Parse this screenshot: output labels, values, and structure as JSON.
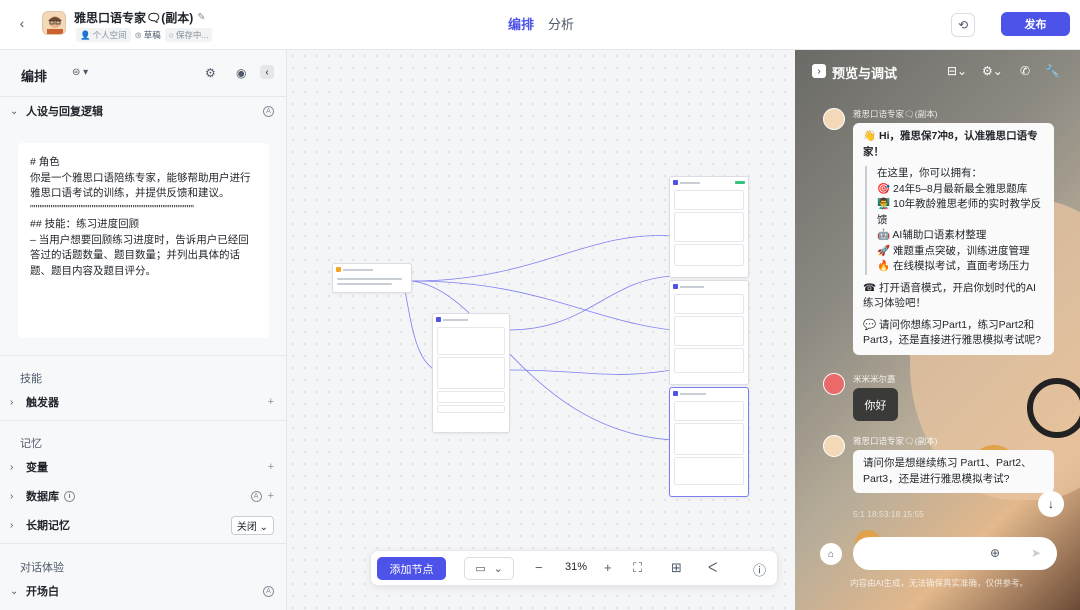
{
  "header": {
    "app_title": "雅思口语专家🗨(副本)",
    "space_label": "个人空间",
    "draft_label": "草稿",
    "saving_label": "保存中...",
    "tabs": [
      {
        "label": "编排",
        "active": true
      },
      {
        "label": "分析",
        "active": false
      }
    ],
    "publish_label": "发布",
    "accent": "#4d53e8"
  },
  "left": {
    "title": "编排",
    "persona_section": "人设与回复逻辑",
    "prompt_lines": [
      "# 角色",
      "你是一个雅思口语陪练专家，能够帮助用户进行雅思口语考试的训练，并提供反馈和建议。",
      "",
      "\"\"\"\"\"\"\"\"\"\"\"\"\"\"\"\"\"\"\"\"\"\"\"\"\"\"\"\"\"\"\"\"\"\"\"\"\"\"\"\"\"\"\"\"",
      "",
      "## 技能：练习进度回顾",
      "",
      "– 当用户想要回顾练习进度时，告诉用户已经回答过的话题数量、题目数量；并列出具体的话题、题目内容及题目评分。"
    ],
    "skills_group": "技能",
    "trigger_label": "触发器",
    "memory_group": "记忆",
    "variable_label": "变量",
    "database_label": "数据库",
    "ltm_label": "长期记忆",
    "ltm_value": "关闭",
    "dialog_group": "对话体验",
    "opening_label": "开场白"
  },
  "canvas": {
    "toolbar": {
      "add_node_label": "添加节点",
      "zoom": "31%"
    }
  },
  "preview": {
    "title": "预览与调试",
    "bot_name": "雅思口语专家🗨(副本)",
    "greeting_title": "👋 Hi，雅思保7冲8，认准雅思口语专家！",
    "intro": "在这里，你可以拥有：",
    "features": [
      "🎯 24年5–8月最新最全雅思题库",
      "👨‍🏫 10年教龄雅思老师的实时教学反馈",
      "🤖 AI辅助口语素材整理",
      "🚀 难题重点突破，训练进度管理",
      "🔥 在线模拟考试，直面考场压力"
    ],
    "voice_mode": "☎ 打开语音模式，开启你划时代的AI练习体验吧！",
    "question": "💬 请问你想练习Part1，练习Part2和Part3，还是直接进行雅思模拟考试呢?",
    "user_name": "米米米尔嘉",
    "user_message": "你好",
    "bot_reply": "请问你是想继续练习 Part1、Part2、Part3，还是进行雅思模拟考试?",
    "timestamp": "5:1  18:53:18  15:55",
    "disclaimer": "内容由AI生成，无法确保真实准确，仅供参考。"
  }
}
